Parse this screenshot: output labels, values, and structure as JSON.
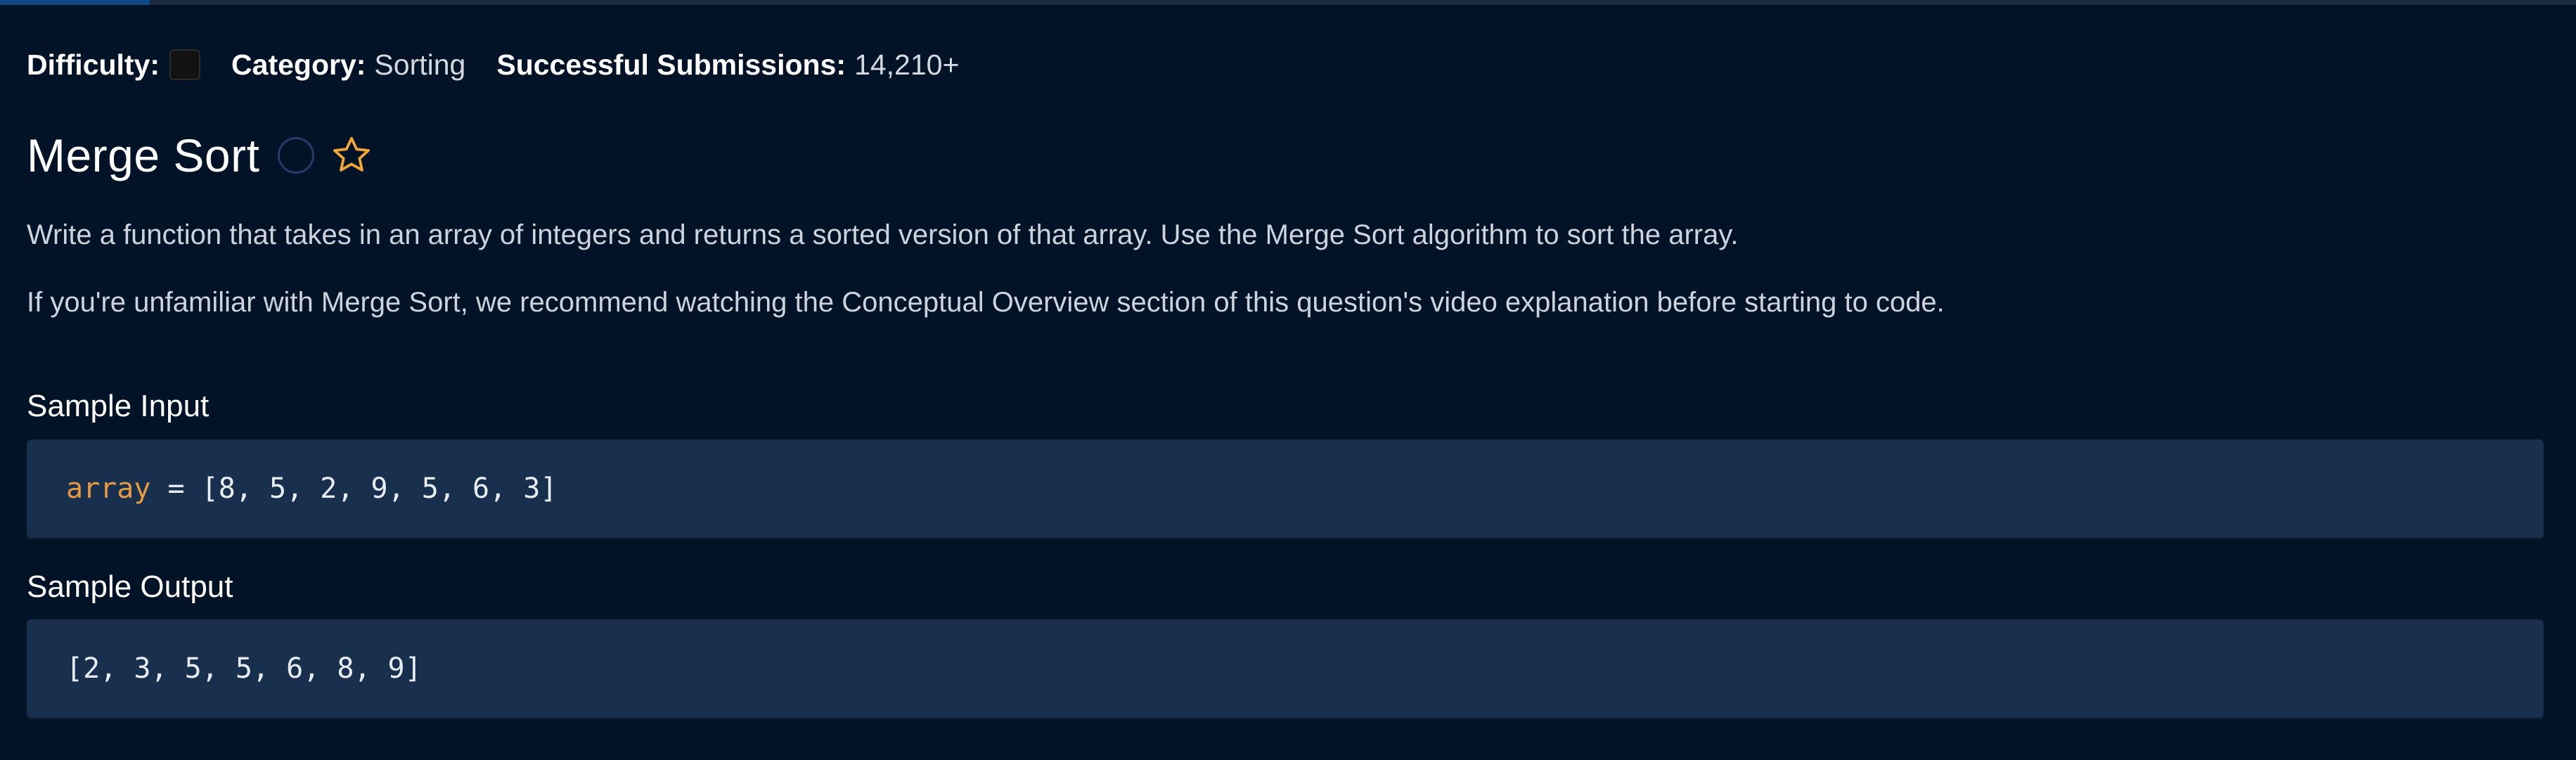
{
  "meta": {
    "difficulty_label": "Difficulty:",
    "category_label": "Category:",
    "category_value": "Sorting",
    "submissions_label": "Successful Submissions:",
    "submissions_value": "14,210+"
  },
  "question": {
    "title": "Merge Sort",
    "status_icon": "unsolved-circle-icon",
    "favorite_icon": "star-outline-icon",
    "description": [
      "Write a function that takes in an array of integers and returns a sorted version of that array. Use the Merge Sort algorithm to sort the array.",
      "If you're unfamiliar with Merge Sort, we recommend watching the Conceptual Overview section of this question's video explanation before starting to code."
    ]
  },
  "sample_input": {
    "heading": "Sample Input",
    "variable": "array",
    "operator": " = ",
    "value": "[8, 5, 2, 9, 5, 6, 3]"
  },
  "sample_output": {
    "heading": "Sample Output",
    "value": "[2, 3, 5, 5, 6, 8, 9]"
  },
  "progress_fraction": 0.058,
  "colors": {
    "background": "#021227",
    "code_background": "#18304d",
    "code_variable": "#e49a45",
    "star": "#f0a53a",
    "status_circle": "#253c6b"
  }
}
